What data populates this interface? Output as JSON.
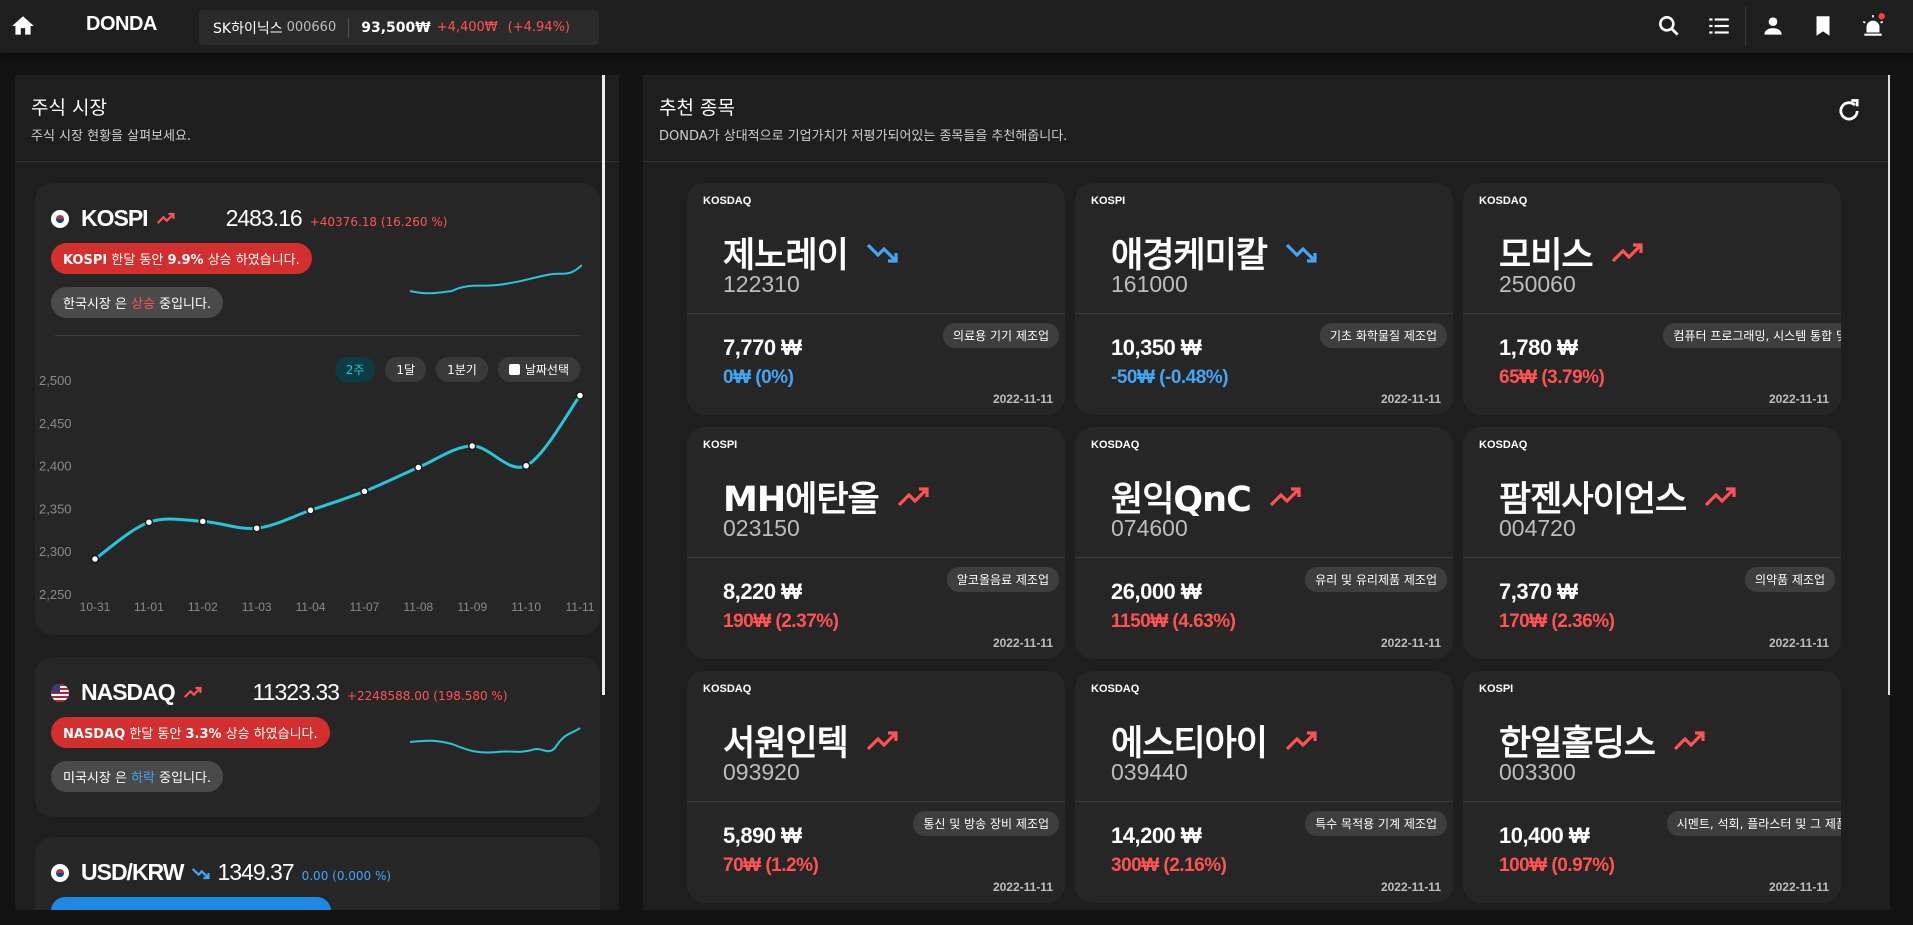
{
  "topbar": {
    "logo": "DONDA",
    "ticker": {
      "name": "SK하이닉스",
      "code": "000660",
      "price": "93,500₩",
      "change": "+4,400₩",
      "percent": "(+4.94%)"
    },
    "icons": [
      "home-icon",
      "search-icon",
      "list-icon",
      "account-icon",
      "bookmark-icon",
      "alarm-icon"
    ]
  },
  "market": {
    "title": "주식 시장",
    "subtitle": "주식 시장 현황을 살펴보세요.",
    "kospi": {
      "name": "KOSPI",
      "value": "2483.16",
      "change": "+40376.18 (16.260 %)",
      "pill_prefix": "KOSPI",
      "pill_mid": " 한달 동안 ",
      "pill_pct": "9.9%",
      "pill_suffix": " 상승 하였습니다.",
      "status_prefix": "한국시장 은 ",
      "status_word": "상승",
      "status_suffix": " 중입니다.",
      "ranges": [
        "2주",
        "1달",
        "1분기",
        "날짜선택"
      ]
    },
    "nasdaq": {
      "name": "NASDAQ",
      "value": "11323.33",
      "change": "+2248588.00 (198.580 %)",
      "pill_prefix": "NASDAQ",
      "pill_mid": " 한달 동안 ",
      "pill_pct": "3.3%",
      "pill_suffix": " 상승 하였습니다.",
      "status_prefix": "미국시장 은 ",
      "status_word": "하락",
      "status_suffix": " 중입니다."
    },
    "usdkrw": {
      "name": "USD/KRW",
      "value": "1349.37",
      "change": "0.00 (0.000 %)"
    }
  },
  "chart_data": {
    "type": "line",
    "x": [
      "10-31",
      "11-01",
      "11-02",
      "11-03",
      "11-04",
      "11-07",
      "11-08",
      "11-09",
      "11-10",
      "11-11"
    ],
    "y_ticks": [
      "2,500",
      "2,450",
      "2,400",
      "2,350",
      "2,300",
      "2,250"
    ],
    "ylim": [
      2250,
      2500
    ],
    "series": [
      {
        "values": [
          2292,
          2335,
          2336,
          2328,
          2349,
          2371,
          2399,
          2424,
          2401,
          2483
        ]
      }
    ],
    "line_color": "#26c6da"
  },
  "recommend": {
    "title": "추천 종목",
    "subtitle": "DONDA가 상대적으로 기업가치가 저평가되어있는 종목들을 추천해줍니다.",
    "stocks": [
      {
        "market": "KOSDAQ",
        "name": "제노레이",
        "code": "122310",
        "industry": "의료용 기기 제조업",
        "price": "7,770 ₩",
        "change": "0₩ (0%)",
        "dir": "down",
        "date": "2022-11-11"
      },
      {
        "market": "KOSPI",
        "name": "애경케미칼",
        "code": "161000",
        "industry": "기초 화학물질 제조업",
        "price": "10,350 ₩",
        "change": "-50₩ (-0.48%)",
        "dir": "down",
        "date": "2022-11-11"
      },
      {
        "market": "KOSDAQ",
        "name": "모비스",
        "code": "250060",
        "industry": "컴퓨터 프로그래밍, 시스템 통합 및",
        "price": "1,780 ₩",
        "change": "65₩ (3.79%)",
        "dir": "up",
        "date": "2022-11-11"
      },
      {
        "market": "KOSPI",
        "name": "MH에탄올",
        "code": "023150",
        "industry": "알코올음료 제조업",
        "price": "8,220 ₩",
        "change": "190₩ (2.37%)",
        "dir": "up",
        "date": "2022-11-11"
      },
      {
        "market": "KOSDAQ",
        "name": "원익QnC",
        "code": "074600",
        "industry": "유리 및 유리제품 제조업",
        "price": "26,000 ₩",
        "change": "1150₩ (4.63%)",
        "dir": "up",
        "date": "2022-11-11"
      },
      {
        "market": "KOSDAQ",
        "name": "팜젠사이언스",
        "code": "004720",
        "industry": "의약품 제조업",
        "price": "7,370 ₩",
        "change": "170₩ (2.36%)",
        "dir": "up",
        "date": "2022-11-11"
      },
      {
        "market": "KOSDAQ",
        "name": "서원인텍",
        "code": "093920",
        "industry": "통신 및 방송 장비 제조업",
        "price": "5,890 ₩",
        "change": "70₩ (1.2%)",
        "dir": "up",
        "date": "2022-11-11"
      },
      {
        "market": "KOSDAQ",
        "name": "에스티아이",
        "code": "039440",
        "industry": "특수 목적용 기계 제조업",
        "price": "14,200 ₩",
        "change": "300₩ (2.16%)",
        "dir": "up",
        "date": "2022-11-11"
      },
      {
        "market": "KOSPI",
        "name": "한일홀딩스",
        "code": "003300",
        "industry": "시멘트, 석회, 플라스터 및 그 제품",
        "price": "10,400 ₩",
        "change": "100₩ (0.97%)",
        "dir": "up",
        "date": "2022-11-11"
      }
    ]
  },
  "colors": {
    "up": "#ff5252",
    "down": "#42a5f5",
    "accent": "#26c6da",
    "bg": "#121212",
    "panel": "#1e1e1e",
    "card": "#262626"
  }
}
